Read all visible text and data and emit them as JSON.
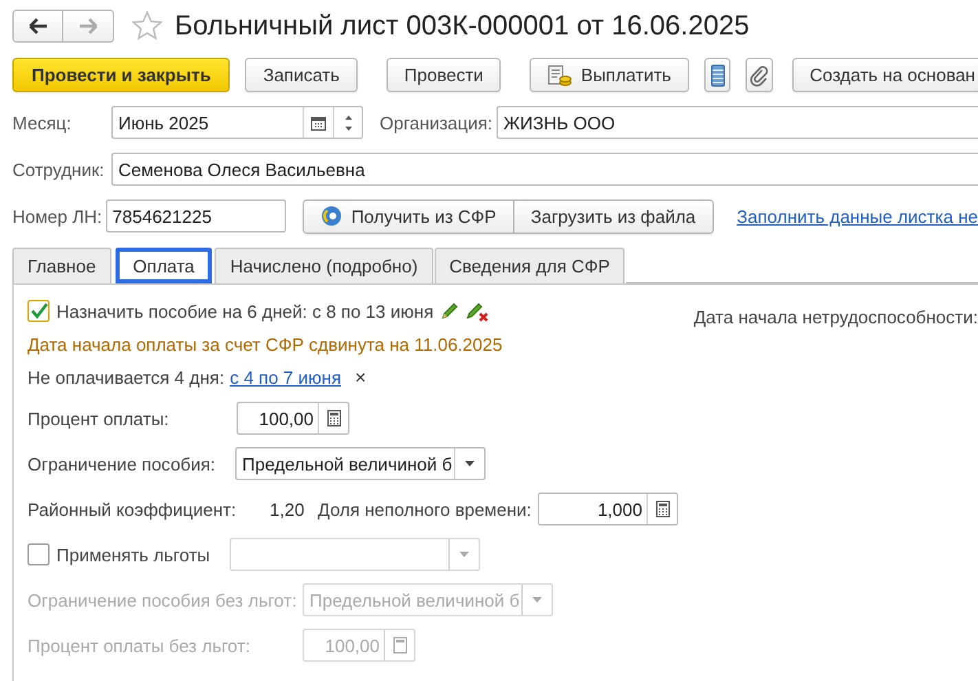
{
  "window": {
    "title": "Больничный лист 003К-000001 от 16.06.2025",
    "favorite": false
  },
  "toolbar": [
    {
      "kind": "primary",
      "label": "Провести и закрыть"
    },
    {
      "kind": "text",
      "label": "Записать"
    },
    {
      "kind": "text",
      "label": "Провести"
    },
    {
      "kind": "pay",
      "label": "Выплатить"
    },
    {
      "kind": "list"
    },
    {
      "kind": "clip"
    },
    {
      "kind": "text",
      "label": "Создать на основан"
    }
  ],
  "month": {
    "label": "Месяц:",
    "value": "Июнь 2025"
  },
  "organization": {
    "label": "Организация:",
    "value": "ЖИЗНЬ ООО"
  },
  "employee": {
    "label": "Сотрудник:",
    "value": "Семенова Олеся Васильевна"
  },
  "sick_leave_number": {
    "label": "Номер ЛН:",
    "value": "7854621225"
  },
  "sfr_buttons": [
    {
      "kind": "sfr",
      "label": "Получить из СФР"
    },
    {
      "kind": "text",
      "label": "Загрузить из файла"
    }
  ],
  "fill_link": "Заполнить данные листка не",
  "tabs": [
    {
      "label": "Главное",
      "selected": false
    },
    {
      "label": "Оплата",
      "selected": true
    },
    {
      "label": "Начислено (подробно)",
      "selected": false
    },
    {
      "label": "Сведения для СФР",
      "selected": false
    }
  ],
  "payment": {
    "assign": {
      "checked": true,
      "text": "Назначить пособие на 6 дней: с 8 по 13 июня"
    },
    "incapacity_start_label": "Дата начала нетрудоспособности:",
    "notice": "Дата начала оплаты за счет СФР сдвинута на 11.06.2025",
    "unpaid": {
      "label": "Не оплачивается 4 дня:",
      "link": "с 4 по 7 июня",
      "remove": "×"
    },
    "payment_percent": {
      "label": "Процент оплаты:",
      "value": "100,00",
      "disabled": false
    },
    "benefit_limit": {
      "label": "Ограничение пособия:",
      "value": "Предельной величиной б",
      "disabled": false
    },
    "regional": {
      "label": "Районный коэффициент:",
      "value": "1,20"
    },
    "part_time": {
      "label": "Доля неполного времени:",
      "value": "1,000"
    },
    "benefits": {
      "checked": false,
      "label": "Применять льготы"
    },
    "limit_without": {
      "label": "Ограничение пособия без льгот:",
      "value": "Предельной величиной б",
      "disabled": true
    },
    "percent_without": {
      "label": "Процент оплаты без льгот:",
      "value": "100,00",
      "disabled": true
    }
  }
}
